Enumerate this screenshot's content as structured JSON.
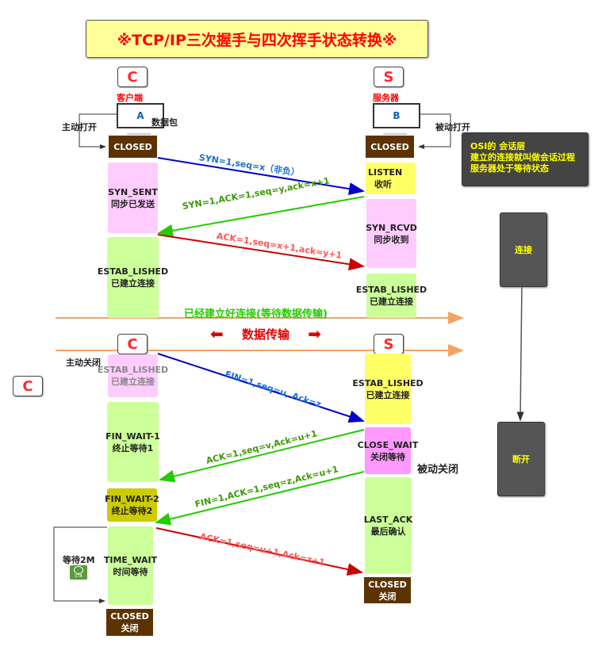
{
  "title": "※TCP/IP三次握手与四次挥手状态转换※",
  "client": {
    "node_label": "C",
    "role": "客户端",
    "host": "A",
    "packet_label": "数据包",
    "open_label": "主动打开"
  },
  "server": {
    "node_label": "S",
    "role": "服务器",
    "host": "B",
    "open_label": "被动打开"
  },
  "note": {
    "lines": [
      "OSI的 会话层",
      "建立的连接就叫做会话过程",
      "服务器处于等待状态"
    ]
  },
  "side_flow": {
    "connect": "连接",
    "disconnect": "断开"
  },
  "handshake": {
    "client_states": [
      {
        "name": "CLOSED",
        "desc": ""
      },
      {
        "name": "SYN_SENT",
        "desc": "同步已发送"
      },
      {
        "name": "ESTAB_LISHED",
        "desc": "已建立连接"
      }
    ],
    "server_states": [
      {
        "name": "CLOSED",
        "desc": ""
      },
      {
        "name": "LISTEN",
        "desc": "收听"
      },
      {
        "name": "SYN_RCVD",
        "desc": "同步收到"
      },
      {
        "name": "ESTAB_LISHED",
        "desc": "已建立连接"
      }
    ],
    "messages": [
      {
        "text": "SYN=1,seq=x（非负）",
        "color": "#0000cc",
        "text_color": "#1a6fd6",
        "direction": "client-to-server"
      },
      {
        "text": "SYN=1,ACK=1,seq=y,ack=x+1",
        "color": "#22cc00",
        "text_color": "#3a9a00",
        "direction": "server-to-client"
      },
      {
        "text": "ACK=1,seq=x+1,ack=y+1",
        "color": "#cc0000",
        "text_color": "#ff5555",
        "direction": "client-to-server"
      }
    ]
  },
  "established_banner": "已经建立好连接(等待数据传输)",
  "data_transfer": "数据传输",
  "teardown": {
    "active_close_label": "主动关闭",
    "passive_close_label": "被动关闭",
    "extra_node": "C",
    "client_node": "C",
    "server_node": "S",
    "client_states": [
      {
        "name": "ESTAB_LISHED",
        "desc": "已建立连接"
      },
      {
        "name": "FIN_WAIT-1",
        "desc": "终止等待1"
      },
      {
        "name": "FIN_WAIT-2",
        "desc": "终止等待2"
      },
      {
        "name": "TIME_WAIT",
        "desc": "时间等待"
      },
      {
        "name": "CLOSED",
        "desc": "关闭"
      }
    ],
    "server_states": [
      {
        "name": "ESTAB_LISHED",
        "desc": "已建立连接"
      },
      {
        "name": "CLOSE_WAIT",
        "desc": "关闭等待"
      },
      {
        "name": "LAST_ACK",
        "desc": "最后确认"
      },
      {
        "name": "CLOSED",
        "desc": "关闭"
      }
    ],
    "messages": [
      {
        "text": "FIN=1,seq=u, Ack=z",
        "color": "#0000cc",
        "text_color": "#1a6fd6",
        "direction": "client-to-server"
      },
      {
        "text": "ACK=1,seq=v,Ack=u+1",
        "color": "#22cc00",
        "text_color": "#3a9a00",
        "direction": "server-to-client"
      },
      {
        "text": "FIN=1,ACK=1,seq=z,Ack=u+1",
        "color": "#22cc00",
        "text_color": "#3a9a00",
        "direction": "server-to-client"
      },
      {
        "text": "ACK=1,seq=u+1,Ack=z+1",
        "color": "#cc0000",
        "text_color": "#ff5555",
        "direction": "client-to-server"
      }
    ],
    "wait_label": "等待2M",
    "timer_label": "STB"
  }
}
